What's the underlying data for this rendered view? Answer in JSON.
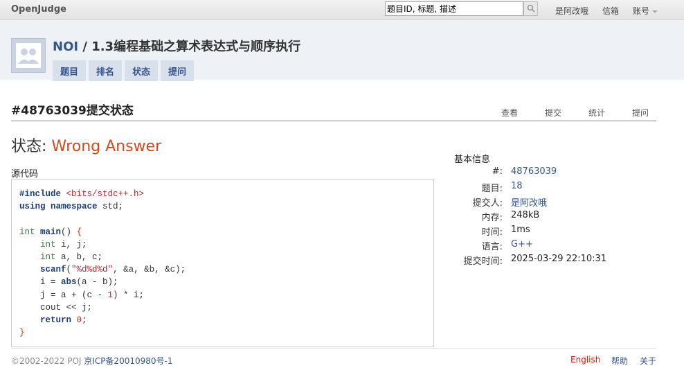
{
  "topbar": {
    "brand": "OpenJudge",
    "search_value": "题目ID, 标题, 描述",
    "links": [
      "是阿改哦",
      "信箱",
      "账号"
    ]
  },
  "header": {
    "group": "NOI",
    "separator": " / ",
    "course": "1.3编程基础之算术表达式与顺序执行",
    "tabs": [
      "题目",
      "排名",
      "状态",
      "提问"
    ]
  },
  "submission": {
    "title": "#48763039提交状态",
    "actions": [
      "查看",
      "提交",
      "统计",
      "提问"
    ],
    "status_label": "状态: ",
    "status_value": "Wrong Answer",
    "source_label": "源代码"
  },
  "info": {
    "title": "基本信息",
    "rows": [
      {
        "key": "#:",
        "value": "48763039"
      },
      {
        "key": "题目:",
        "value": "18"
      },
      {
        "key": "提交人:",
        "value": "是阿改哦"
      },
      {
        "key": "内存:",
        "value": "248kB"
      },
      {
        "key": "时间:",
        "value": "1ms"
      },
      {
        "key": "语言:",
        "value": "G++"
      },
      {
        "key": "提交时间:",
        "value": "2025-03-29 22:10:31"
      }
    ]
  },
  "footer": {
    "copyright": "©2002-2022 POJ",
    "icp": "京ICP备20010980号-1",
    "links": [
      "English",
      "帮助",
      "关于"
    ]
  },
  "colors": {
    "accent": "#36558a",
    "status_error": "#d24a1d"
  },
  "icons": [
    "search-icon",
    "user-avatar-icon",
    "chevron-down-icon"
  ]
}
